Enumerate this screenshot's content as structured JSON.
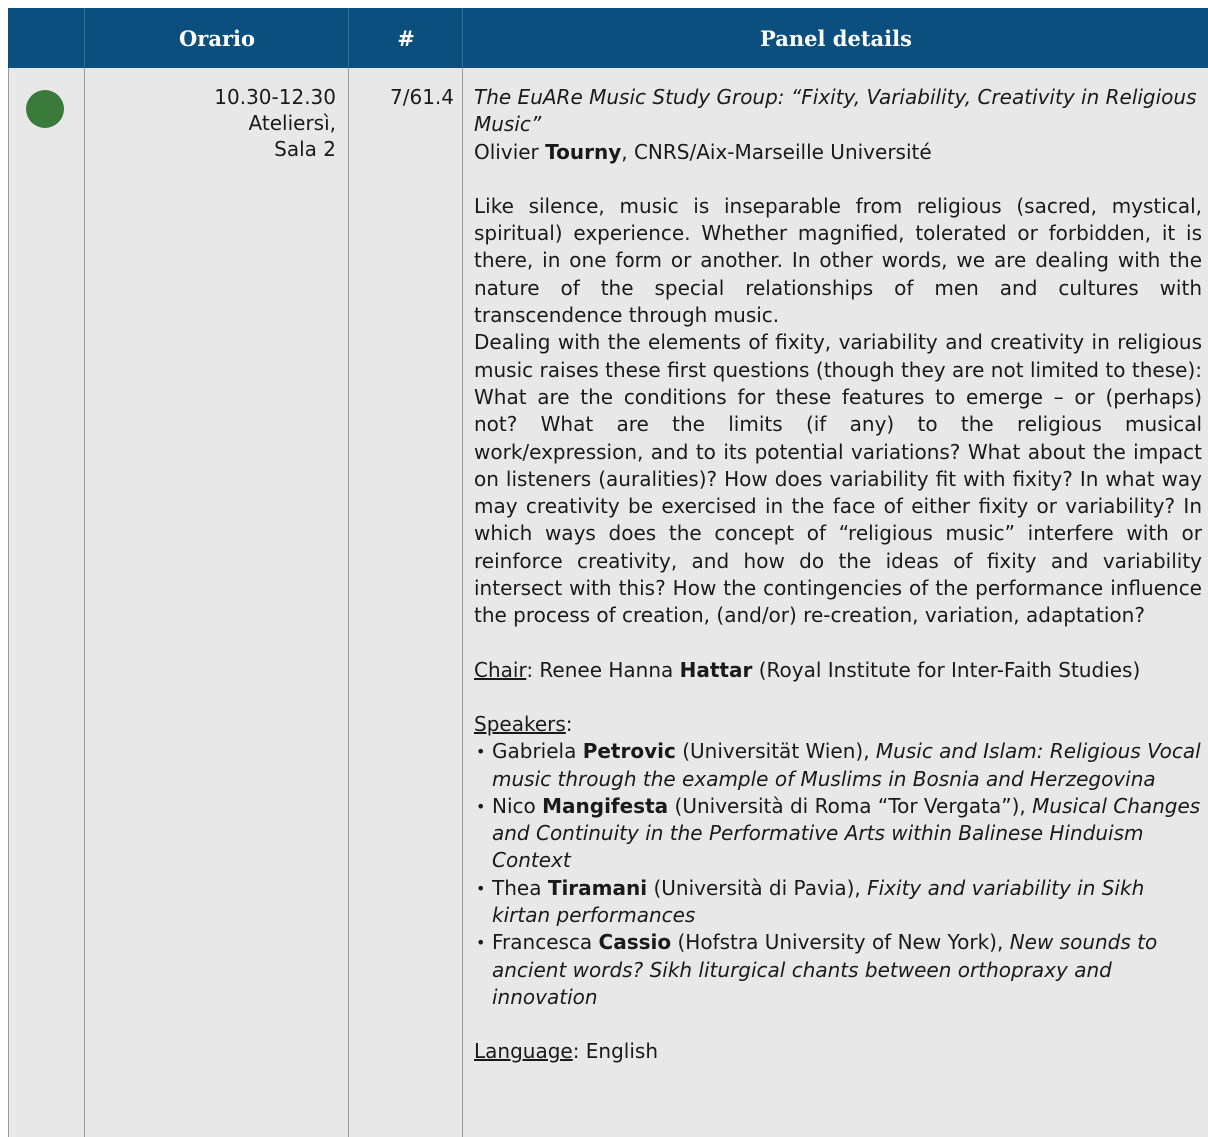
{
  "header": {
    "col_orario": "Orario",
    "col_num": "#",
    "col_details": "Panel details"
  },
  "colors": {
    "header_bg": "#0b4f7f",
    "row_bg": "#e8e8e8",
    "dot": "#3a7a3a"
  },
  "row": {
    "status_icon": "green-circle-icon",
    "time": "10.30-12.30",
    "place_line1": "Ateliersì,",
    "place_line2": "Sala 2",
    "number": "7/61.4",
    "title": "The EuARe Music Study Group: “Fixity, Variability, Creativity in Religious Music”",
    "organizer_first": "Olivier ",
    "organizer_last": "Tourny",
    "organizer_affil": ", CNRS/Aix-Marseille Université",
    "abstract_p1": "Like silence, music is inseparable from religious (sacred, mystical, spiritual) experience. Whether magnified, tolerated or forbidden, it is there, in one form or another. In other words, we are dealing with the nature of the special relationships of men and cultures with transcendence through music.",
    "abstract_p2": "Dealing with the elements of fixity, variability and creativity in religious music raises these first questions (though they are not limited to these): What are the conditions for these features to emerge – or (perhaps) not? What are the limits (if any) to the religious musical work/expression, and to its potential variations? What about the impact on listeners (auralities)? How does variability fit with fixity? In what way may creativity be exercised in the face of either fixity or variability? In which ways does the concept of “religious music” interfere with or reinforce creativity, and how do the ideas of fixity and variability intersect with this? How the contingencies of the performance influence the process of creation, (and/or) re-creation, variation, adaptation?",
    "chair_label": "Chair",
    "chair_first": ": Renee Hanna ",
    "chair_last": "Hattar",
    "chair_affil": " (Royal Institute for Inter-Faith Studies)",
    "speakers_label": "Speakers",
    "speakers_colon": ":",
    "speakers": [
      {
        "first": "Gabriela ",
        "last": "Petrovic",
        "affil": " (Universität Wien), ",
        "talk": "Music and Islam: Religious Vocal music through the example of Muslims in Bosnia and Herzegovina"
      },
      {
        "first": "Nico ",
        "last": "Mangifesta",
        "affil": " (Università di Roma “Tor Vergata”), ",
        "talk": "Musical Changes and Continuity in the Performative Arts within Balinese Hinduism Context"
      },
      {
        "first": "Thea ",
        "last": "Tiramani",
        "affil": " (Università di Pavia), ",
        "talk": "Fixity and variability in Sikh kirtan performances"
      },
      {
        "first": "Francesca ",
        "last": "Cassio",
        "affil": " (Hofstra University of New York), ",
        "talk": "New sounds to ancient words? Sikh liturgical chants between orthopraxy and innovation"
      }
    ],
    "language_label": "Language",
    "language_value": ": English"
  }
}
